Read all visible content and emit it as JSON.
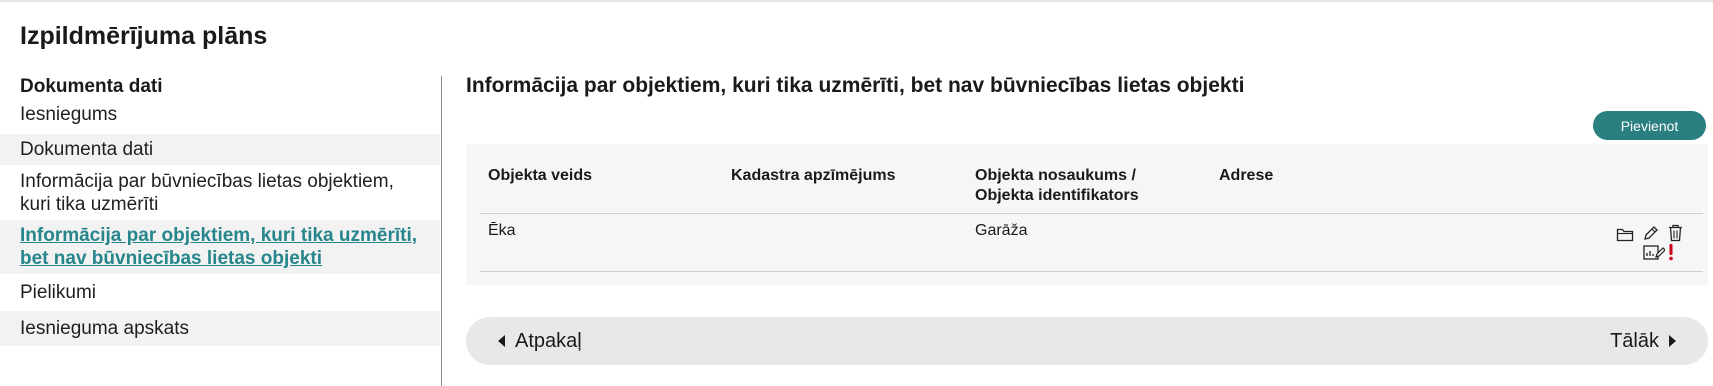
{
  "page": {
    "title": "Izpildmērījuma plāns"
  },
  "sidebar": {
    "heading": "Dokumenta dati",
    "items": [
      {
        "label": "Iesniegums",
        "state": "normal"
      },
      {
        "label": "Dokumenta dati",
        "state": "shaded"
      },
      {
        "label": "Informācija par būvniecības lietas objektiem, kuri tika uzmērīti",
        "state": "normal"
      },
      {
        "label": "Informācija par objektiem, kuri tika uzmērīti, bet nav būvniecības lietas objekti",
        "state": "active"
      },
      {
        "label": "Pielikumi",
        "state": "normal"
      },
      {
        "label": "Iesnieguma apskats",
        "state": "shaded"
      }
    ]
  },
  "main": {
    "section_title": "Informācija par objektiem, kuri tika uzmērīti, bet nav būvniecības lietas objekti",
    "add_label": "Pievienot",
    "table": {
      "columns": [
        "Objekta veids",
        "Kadastra apzīmējums",
        "Objekta nosaukums / Objekta identifikators",
        "Adrese"
      ],
      "rows": [
        {
          "veids": "Ēka",
          "kadastrs": "",
          "nosaukums": "Garāža",
          "adrese": ""
        }
      ],
      "row_icons": [
        "folder-icon",
        "edit-pencil-icon",
        "trash-icon",
        "document-edit-icon",
        "warning-exclamation-icon"
      ]
    }
  },
  "navigation": {
    "back_label": "Atpakaļ",
    "next_label": "Tālāk"
  },
  "colors": {
    "accent": "#26868b",
    "button": "#2a7f80",
    "warning": "#d0021b"
  }
}
